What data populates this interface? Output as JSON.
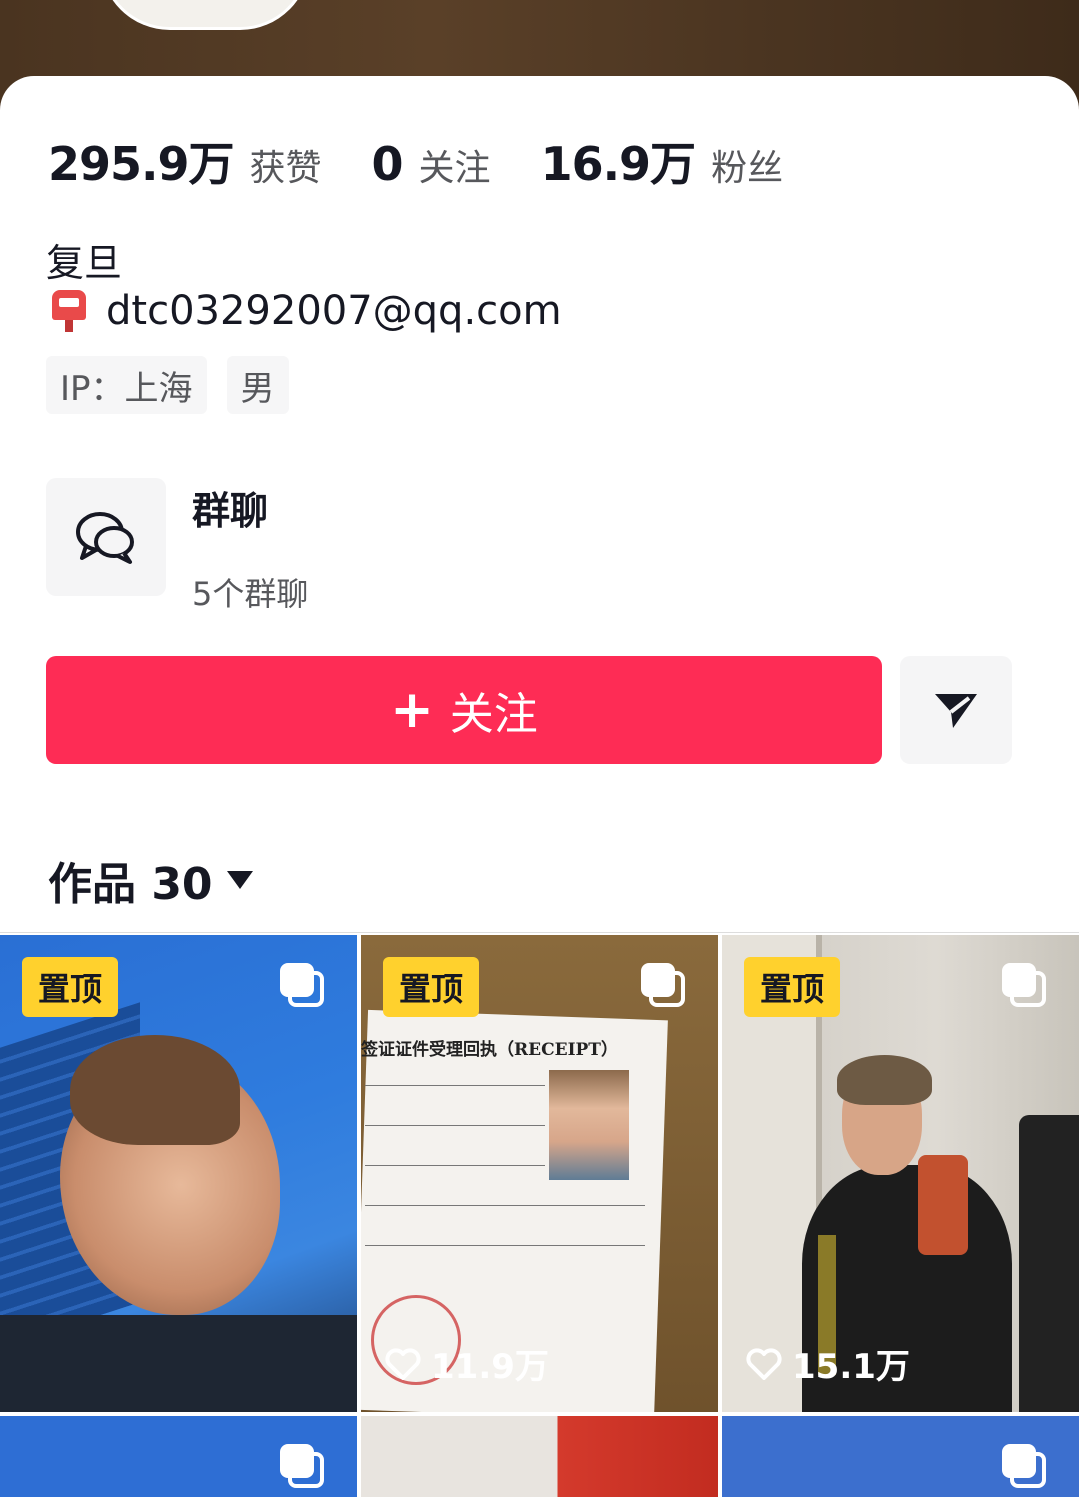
{
  "profile": {
    "stats": [
      {
        "value": "295.9万",
        "label": "获赞"
      },
      {
        "value": "0",
        "label": "关注"
      },
      {
        "value": "16.9万",
        "label": "粉丝"
      }
    ],
    "bio": "复旦",
    "email": "dtc03292007@qq.com",
    "tags": [
      "IP：上海",
      "男"
    ]
  },
  "group_chat": {
    "title": "群聊",
    "subtitle": "5个群聊"
  },
  "actions": {
    "follow_label": "关注",
    "follow_plus": "+"
  },
  "works": {
    "label": "作品 30"
  },
  "grid": {
    "pin_label": "置顶",
    "items": [
      {
        "pinned": true,
        "likes": ""
      },
      {
        "pinned": true,
        "likes": "11.9万",
        "receipt_title": "签证证件受理回执（RECEIPT）"
      },
      {
        "pinned": true,
        "likes": "15.1万"
      }
    ]
  },
  "icons": [
    "mailbox-icon",
    "group-chat-icon",
    "send-icon",
    "caret-down-icon",
    "multi-image-icon",
    "heart-icon"
  ],
  "colors": {
    "accent": "#fe2c55",
    "pin_badge": "#ffd12d",
    "text": "#161823",
    "secondary": "#57585c"
  }
}
